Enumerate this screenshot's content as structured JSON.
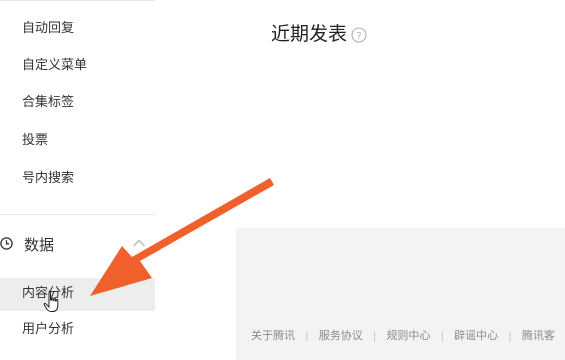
{
  "sidebar": {
    "items": [
      {
        "label": "自动回复"
      },
      {
        "label": "自定义菜单"
      },
      {
        "label": "合集标签"
      },
      {
        "label": "投票"
      },
      {
        "label": "号内搜索"
      }
    ],
    "section": {
      "label": "数据",
      "icon": "clock-icon",
      "expanded": true,
      "children": [
        {
          "label": "内容分析",
          "active": true
        },
        {
          "label": "用户分析",
          "active": false
        }
      ]
    }
  },
  "main": {
    "title": "近期发表",
    "help_icon": "question-circle-icon"
  },
  "footer": {
    "links": [
      "关于腾讯",
      "服务协议",
      "规则中心",
      "辟谣中心",
      "腾讯客"
    ]
  },
  "colors": {
    "arrow": "#f0602c",
    "active_bg": "#ededee",
    "page_bg": "#f2f3f5"
  }
}
